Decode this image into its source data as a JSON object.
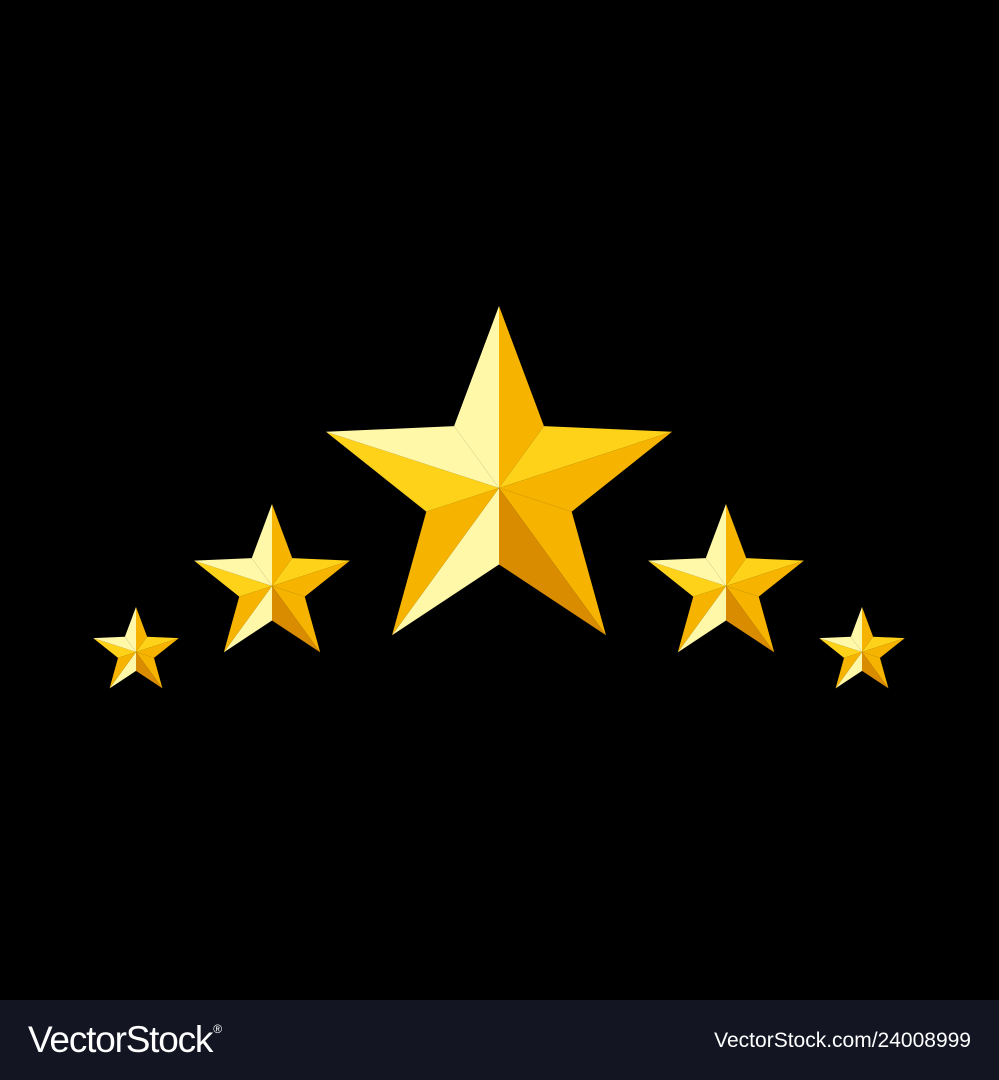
{
  "scene": {
    "background": "#000000",
    "star_colors": {
      "light": "#fff8a8",
      "main": "#ffd21a",
      "mid": "#f6b400",
      "dark": "#d98c00"
    },
    "stars": [
      {
        "name": "star-small-left"
      },
      {
        "name": "star-medium-left"
      },
      {
        "name": "star-large-center"
      },
      {
        "name": "star-medium-right"
      },
      {
        "name": "star-small-right"
      }
    ]
  },
  "footer": {
    "background": "#131523",
    "brand": "VectorStock",
    "brand_mark": "®",
    "image_id": "VectorStock.com/24008999"
  }
}
